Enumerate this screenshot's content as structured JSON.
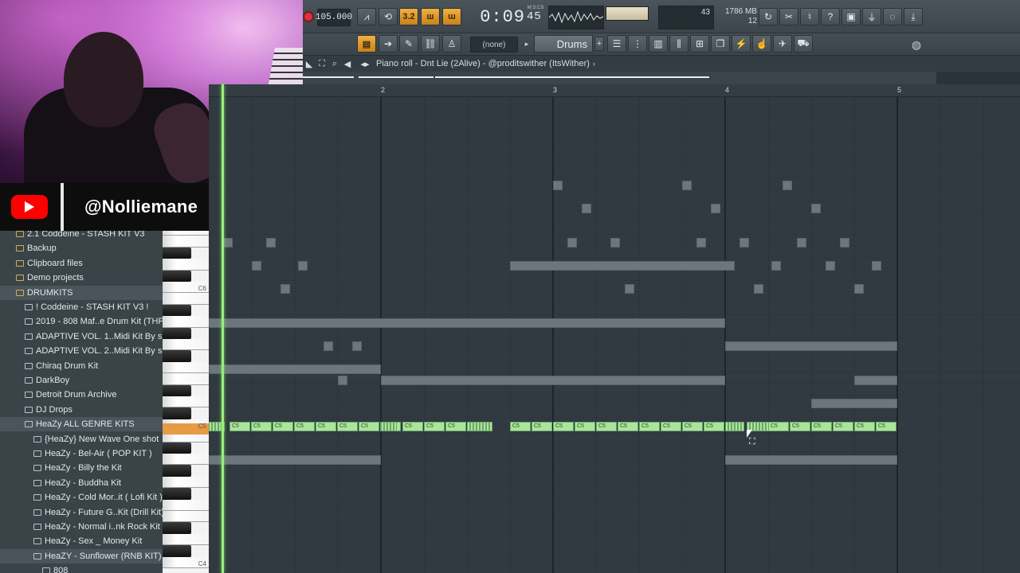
{
  "toolbar": {
    "tempo": "105.000",
    "pattern_mode": "3.2",
    "time": "0:09",
    "time_fraction": "45",
    "time_label": "M:S:CS",
    "cpu": "43",
    "memory": "1786 MB",
    "polyphony": "12",
    "snap": "(none)",
    "channel": "Drums"
  },
  "piano_roll": {
    "title": "Piano roll - Dnt Lie (2Alive) - @proditswither (ItsWither)",
    "bars": [
      "2",
      "3",
      "4",
      "5"
    ],
    "key_labels": {
      "c6": "C6",
      "c5": "C5",
      "c4": "C4"
    },
    "note_label": "C5"
  },
  "browser": {
    "items": [
      {
        "label": "2.1 Coddeine - STASH KIT V3",
        "level": 0
      },
      {
        "label": "Backup",
        "level": 0
      },
      {
        "label": "Clipboard files",
        "level": 0
      },
      {
        "label": "Demo projects",
        "level": 0
      },
      {
        "label": "DRUMKITS",
        "level": 0,
        "open": true
      },
      {
        "label": "! Coddeine - STASH KIT V3 !",
        "level": 1
      },
      {
        "label": "2019 - 808 Maf..e Drum Kit (THP)",
        "level": 1
      },
      {
        "label": "ADAPTIVE VOL. 1..Midi Kit By slim",
        "level": 1
      },
      {
        "label": "ADAPTIVE VOL. 2..Midi Kit By slim",
        "level": 1
      },
      {
        "label": "Chiraq Drum Kit",
        "level": 1
      },
      {
        "label": "DarkBoy",
        "level": 1
      },
      {
        "label": "Detroit Drum Archive",
        "level": 1
      },
      {
        "label": "DJ Drops",
        "level": 1
      },
      {
        "label": "HeaZy ALL GENRE KITS",
        "level": 1,
        "open": true
      },
      {
        "label": "{HeaZy} New Wave One shot",
        "level": 2
      },
      {
        "label": "HeaZy - Bel-Air ( POP KIT )",
        "level": 2
      },
      {
        "label": "HeaZy - Billy the Kit",
        "level": 2
      },
      {
        "label": "HeaZy - Buddha Kit",
        "level": 2
      },
      {
        "label": "HeaZy - Cold Mor..it ( Lofi Kit )",
        "level": 2
      },
      {
        "label": "HeaZy - Future G..Kit (Drill Kit)",
        "level": 2
      },
      {
        "label": "HeaZy - Normal i..nk Rock Kit )",
        "level": 2
      },
      {
        "label": "HeaZy - Sex _ Money Kit",
        "level": 2
      },
      {
        "label": "HeaZY - Sunflower (RNB KIT)",
        "level": 2,
        "open": true
      },
      {
        "label": "808",
        "level": 3
      }
    ]
  },
  "overlay": {
    "handle": "@Nolliemane",
    "platform_icon": "youtube-icon"
  },
  "colors": {
    "accent_orange": "#f0b040",
    "note_green": "#a9e59b",
    "playhead": "#9af07a",
    "youtube_red": "#ff0000"
  }
}
